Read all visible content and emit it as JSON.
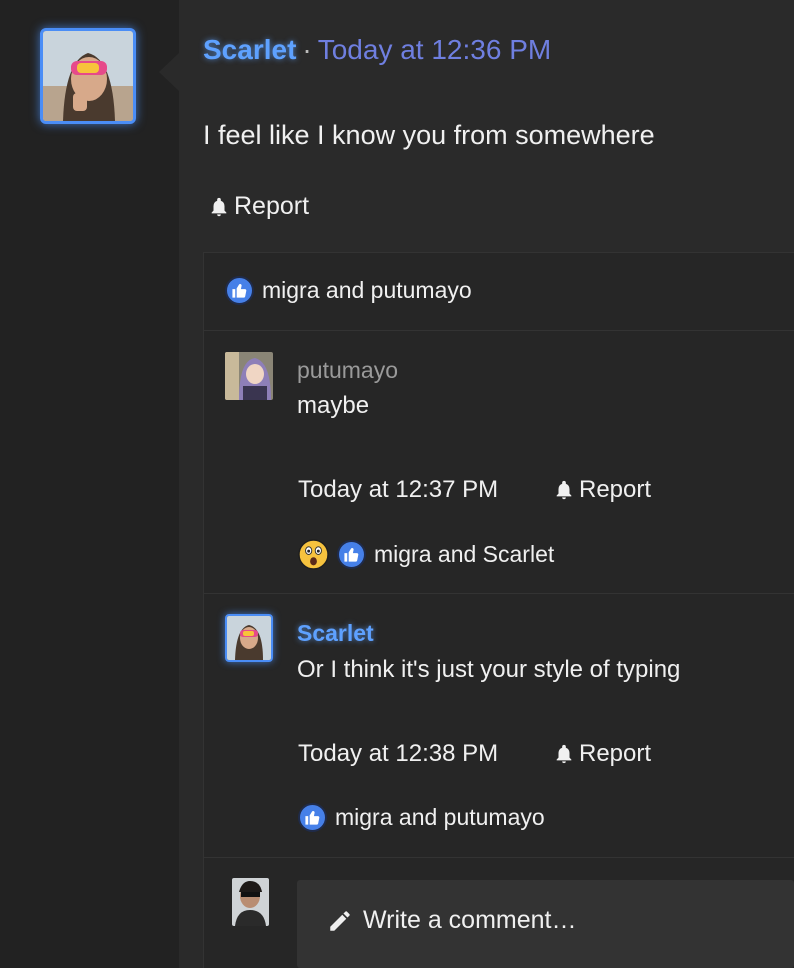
{
  "post": {
    "author": "Scarlet",
    "separator": "·",
    "time": "Today at 12:36 PM",
    "body": "I feel like I know you from somewhere",
    "report_label": "Report",
    "reaction_names": "migra and putumayo"
  },
  "comments": [
    {
      "author": "putumayo",
      "text": "maybe",
      "time": "Today at 12:37 PM",
      "report_label": "Report",
      "reaction_names": "migra and Scarlet",
      "reactions": [
        "wow",
        "like"
      ]
    },
    {
      "author": "Scarlet",
      "text": "Or I think it's just your style of typing",
      "time": "Today at 12:38 PM",
      "report_label": "Report",
      "reaction_names": "migra and putumayo",
      "reactions": [
        "like"
      ]
    }
  ],
  "composer": {
    "placeholder": "Write a comment…"
  },
  "colors": {
    "accent": "#5ea1ff",
    "timestamp": "#6f7fe0",
    "like": "#4680e8",
    "background": "#2a2a2a"
  },
  "icons": [
    "bell-icon",
    "like-icon",
    "wow-emoji-icon",
    "pencil-icon"
  ]
}
